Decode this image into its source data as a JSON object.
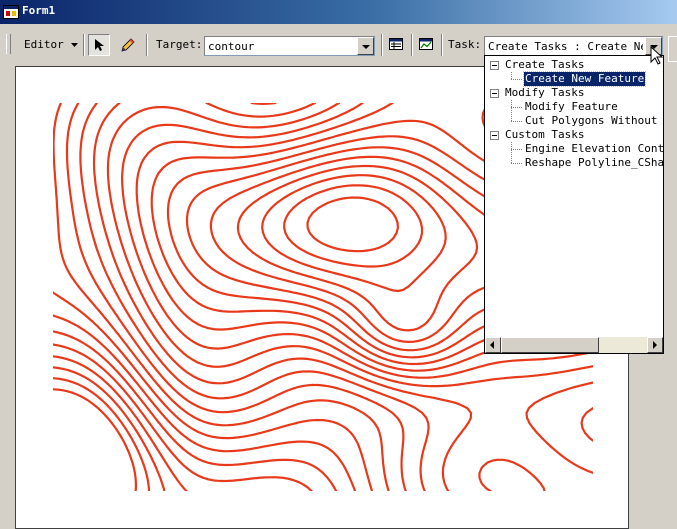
{
  "window": {
    "title": "Form1"
  },
  "toolbar": {
    "editor_label": "Editor",
    "target_label": "Target:",
    "target_value": "contour",
    "task_label": "Task:",
    "task_value": "Create Tasks : Create New Feature"
  },
  "icons": {
    "app": "form-icon",
    "editor_menu": "chevron-down-icon",
    "select_tool": "arrow-pointer-icon",
    "sketch_tool": "pencil-icon",
    "attributes": "attributes-table-icon",
    "sketch_properties": "sketch-properties-icon",
    "mouse_cursor": "mouse-pointer-icon"
  },
  "task_tree": [
    {
      "label": "Create Tasks",
      "children": [
        {
          "label": "Create New Feature",
          "selected": true
        }
      ]
    },
    {
      "label": "Modify Tasks",
      "children": [
        {
          "label": "Modify Feature"
        },
        {
          "label": "Cut Polygons Without Selection"
        }
      ]
    },
    {
      "label": "Custom Tasks",
      "children": [
        {
          "label": "Engine Elevation Contour"
        },
        {
          "label": "Reshape Polyline_CSharp"
        }
      ]
    }
  ],
  "colors": {
    "contour": "#e8391a",
    "selection": "#0a246a",
    "titlebar": "#0a246a"
  }
}
